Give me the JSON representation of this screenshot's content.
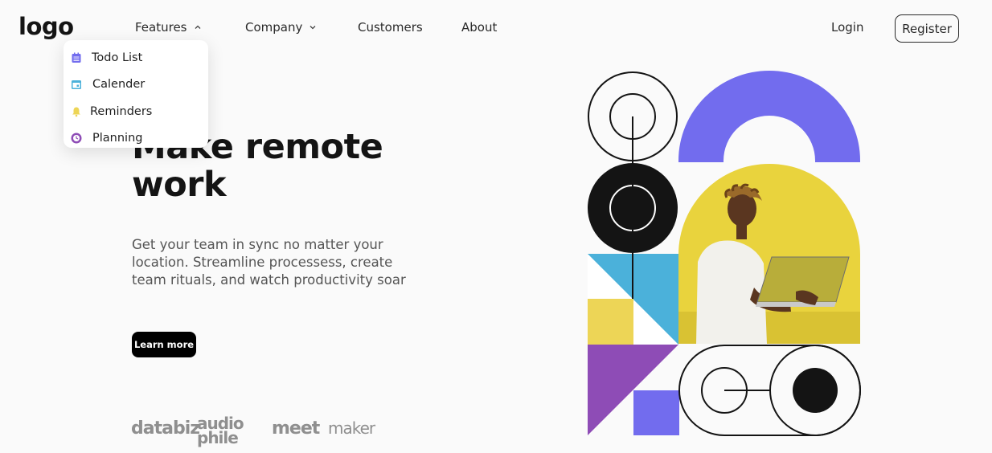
{
  "brand": {
    "logo_text": "logo"
  },
  "nav": {
    "features_label": "Features",
    "company_label": "Company",
    "customers_label": "Customers",
    "about_label": "About",
    "login_label": "Login",
    "register_label": "Register"
  },
  "features_menu": {
    "items": [
      {
        "label": "Todo List",
        "icon": "todo-icon",
        "color": "#726CEE"
      },
      {
        "label": "Calender",
        "icon": "calendar-icon",
        "color": "#4BB1DA"
      },
      {
        "label": "Reminders",
        "icon": "bell-icon",
        "color": "#EDD556"
      },
      {
        "label": "Planning",
        "icon": "planning-icon",
        "color": "#8E4CB6"
      }
    ]
  },
  "hero": {
    "title_line1": "Make remote",
    "title_line2": "work",
    "subtitle": "Get your team in sync no matter your location. Streamline processess, create team rituals, and watch productivity soar",
    "cta_label": "Learn more"
  },
  "clients": [
    "databiz",
    "audiophile",
    "meet",
    "maker"
  ],
  "colors": {
    "accent_purple": "#726CEE",
    "accent_yellow": "#E9D33D",
    "accent_blue": "#4BB1DA",
    "accent_violet": "#8E4CB6",
    "text_dark": "#141414"
  }
}
